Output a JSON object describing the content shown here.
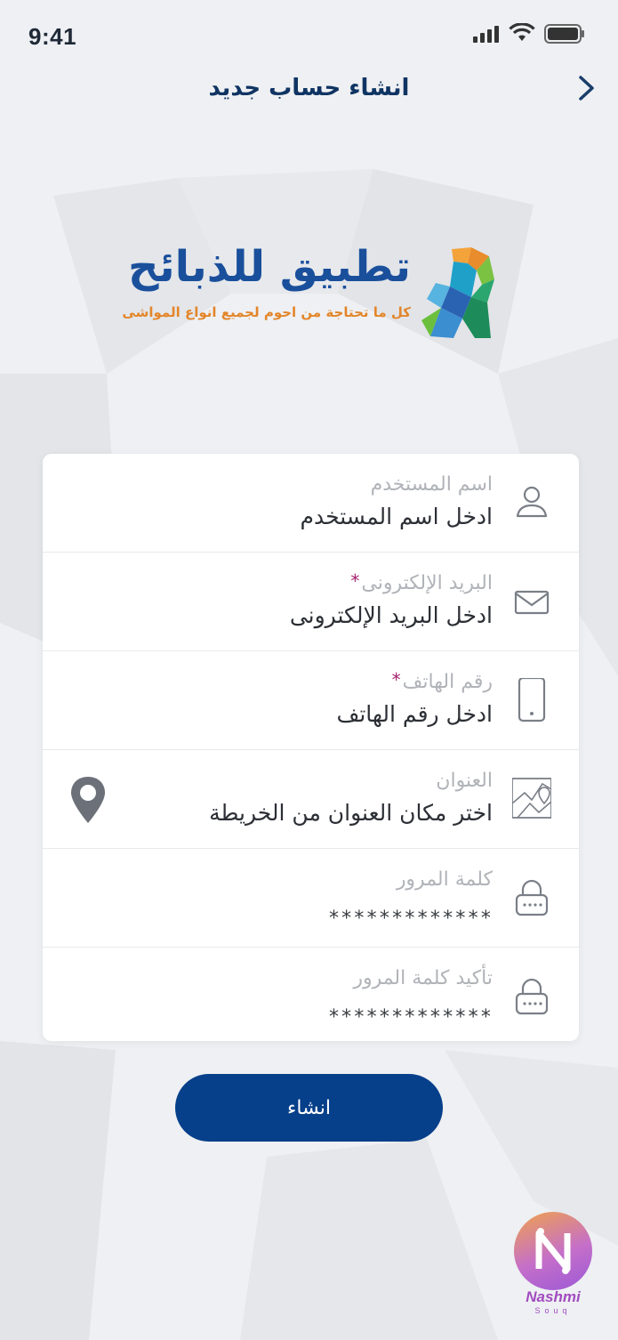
{
  "status_bar": {
    "time": "9:41"
  },
  "header": {
    "title": "انشاء حساب جديد",
    "back_icon": "chevron-right-icon"
  },
  "logo": {
    "title": "تطبيق للذبائح",
    "subtitle": "كل ما تحتاجة من احوم لجميع انواع المواشى",
    "colors": {
      "title": "#1a4f9c",
      "subtitle": "#e3862a"
    }
  },
  "form": {
    "fields": [
      {
        "label": "اسم المستخدم",
        "value": "ادخل اسم المستخدم",
        "required": false,
        "icon": "user-icon"
      },
      {
        "label": "البريد الإلكترونى",
        "value": "ادخل البريد الإلكترونى",
        "required": true,
        "icon": "mail-icon"
      },
      {
        "label": "رقم الهاتف",
        "value": "ادخل رقم الهاتف",
        "required": true,
        "icon": "phone-icon"
      },
      {
        "label": "العنوان",
        "value": "اختر مكان العنوان من الخريطة",
        "required": false,
        "icon": "map-icon",
        "action_icon": "location-pin-icon"
      },
      {
        "label": "كلمة المرور",
        "value": "*************",
        "required": false,
        "icon": "lock-icon"
      },
      {
        "label": "تأكيد كلمة المرور",
        "value": "*************",
        "required": false,
        "icon": "lock-icon"
      }
    ],
    "required_marker": "*"
  },
  "submit": {
    "label": "انشاء"
  },
  "watermark": {
    "name": "Nashmi",
    "sub": "Souq"
  },
  "colors": {
    "primary": "#063f8a",
    "heading": "#0f3463",
    "required": "#a4226f",
    "label": "#b0b3b8"
  }
}
